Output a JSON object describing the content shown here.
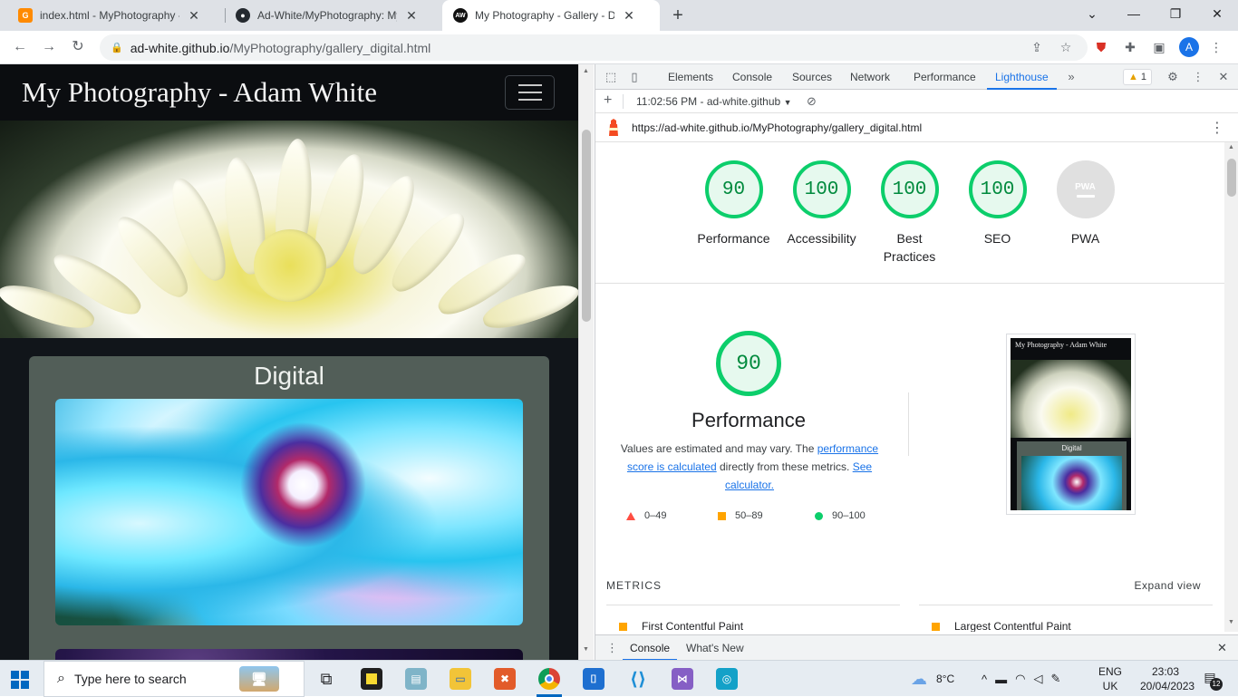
{
  "browser": {
    "tabs": [
      {
        "title": "index.html - MyPhotography - Gi",
        "favicon": "gitpod-icon",
        "favicon_color": "#ff8a00"
      },
      {
        "title": "Ad-White/MyPhotography: My P",
        "favicon": "github-icon",
        "favicon_color": "#24292f"
      },
      {
        "title": "My Photography - Gallery - Digit",
        "favicon": "aw-icon",
        "favicon_text": "AW",
        "favicon_color": "#111111"
      }
    ],
    "close_glyph": "✕",
    "new_tab_glyph": "+",
    "window_controls": {
      "minimize": "—",
      "maximize": "❐",
      "close": "✕",
      "dropdown": "⌄"
    },
    "address": {
      "host": "ad-white.github.io",
      "path": "/MyPhotography/gallery_digital.html"
    },
    "profile_initial": "A"
  },
  "site": {
    "brand": "My Photography - Adam White",
    "section_title": "Digital"
  },
  "devtools": {
    "tabs": [
      "Elements",
      "Console",
      "Sources",
      "Network",
      "Performance",
      "Lighthouse"
    ],
    "active_tab": "Lighthouse",
    "more_glyph": "»",
    "warning_count": "1",
    "report_label": "11:02:56 PM - ad-white.github",
    "report_url": "https://ad-white.github.io/MyPhotography/gallery_digital.html",
    "gauges": [
      {
        "score": "90",
        "label": "Performance"
      },
      {
        "score": "100",
        "label": "Accessibility"
      },
      {
        "score": "100",
        "label": "Best Practices"
      },
      {
        "score": "100",
        "label": "SEO"
      },
      {
        "score": "PWA",
        "label": "PWA"
      }
    ],
    "performance": {
      "score": "90",
      "title": "Performance",
      "note_prefix": "Values are estimated and may vary. The ",
      "note_link1": "performance score is calculated",
      "note_middle": " directly from these metrics. ",
      "note_link2": "See calculator.",
      "legend": [
        {
          "range": "0–49",
          "color": "#ff4e42",
          "shape": "triangle"
        },
        {
          "range": "50–89",
          "color": "#ffa400",
          "shape": "square"
        },
        {
          "range": "90–100",
          "color": "#0cce6b",
          "shape": "circle"
        }
      ]
    },
    "thumbnail": {
      "header": "My Photography - Adam White",
      "section": "Digital"
    },
    "metrics_heading": "METRICS",
    "expand_label": "Expand view",
    "metrics": [
      "First Contentful Paint",
      "Largest Contentful Paint"
    ],
    "drawer_tabs": [
      "Console",
      "What's New"
    ]
  },
  "taskbar": {
    "search_placeholder": "Type here to search",
    "weather": "8°C",
    "lang_top": "ENG",
    "lang_bottom": "UK",
    "time": "23:03",
    "date": "20/04/2023",
    "notification_count": "12"
  },
  "colors": {
    "pass_green": "#0cce6b",
    "average_orange": "#ffa400",
    "fail_red": "#ff4e42",
    "accent_blue": "#1a73e8"
  }
}
